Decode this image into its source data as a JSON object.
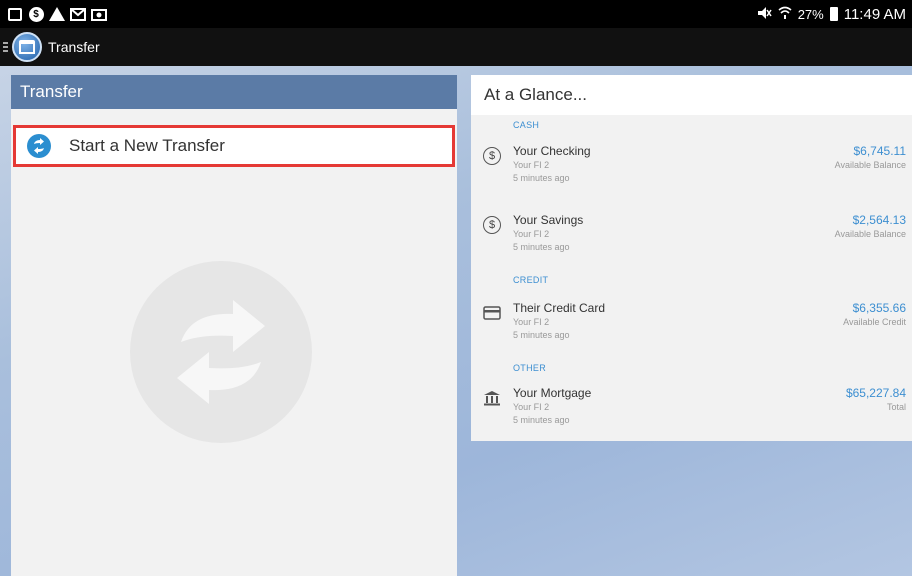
{
  "status_bar": {
    "battery_percent": "27%",
    "time": "11:49 AM",
    "left_icons": [
      "screenshot-icon",
      "dollar-badge-icon",
      "warning-icon",
      "mail-icon",
      "image-icon"
    ],
    "right_icons": [
      "mute-icon",
      "wifi-icon",
      "battery-icon"
    ]
  },
  "action_bar": {
    "title": "Transfer",
    "menu_icon": "drawer-icon",
    "logo_icon": "bank-logo-icon"
  },
  "transfer_panel": {
    "header": "Transfer",
    "start_label": "Start a New Transfer",
    "accent": "#5b7ba6",
    "highlight_color": "#e53935"
  },
  "glance_panel": {
    "header": "At a Glance...",
    "sections": [
      {
        "label": "CASH",
        "accounts": [
          {
            "name": "Your Checking",
            "fi": "Your FI 2",
            "time": "5 minutes ago",
            "amount": "$6,745.11",
            "amount_type": "Available Balance",
            "icon": "dollar-circle-icon"
          },
          {
            "name": "Your Savings",
            "fi": "Your FI 2",
            "time": "5 minutes ago",
            "amount": "$2,564.13",
            "amount_type": "Available Balance",
            "icon": "dollar-circle-icon"
          }
        ]
      },
      {
        "label": "CREDIT",
        "accounts": [
          {
            "name": "Their Credit Card",
            "fi": "Your FI 2",
            "time": "5 minutes ago",
            "amount": "$6,355.66",
            "amount_type": "Available Credit",
            "icon": "credit-card-icon"
          }
        ]
      },
      {
        "label": "OTHER",
        "accounts": [
          {
            "name": "Your Mortgage",
            "fi": "Your FI 2",
            "time": "5 minutes ago",
            "amount": "$65,227.84",
            "amount_type": "Total",
            "icon": "bank-building-icon"
          }
        ]
      }
    ],
    "amount_color": "#3d8fd1"
  }
}
